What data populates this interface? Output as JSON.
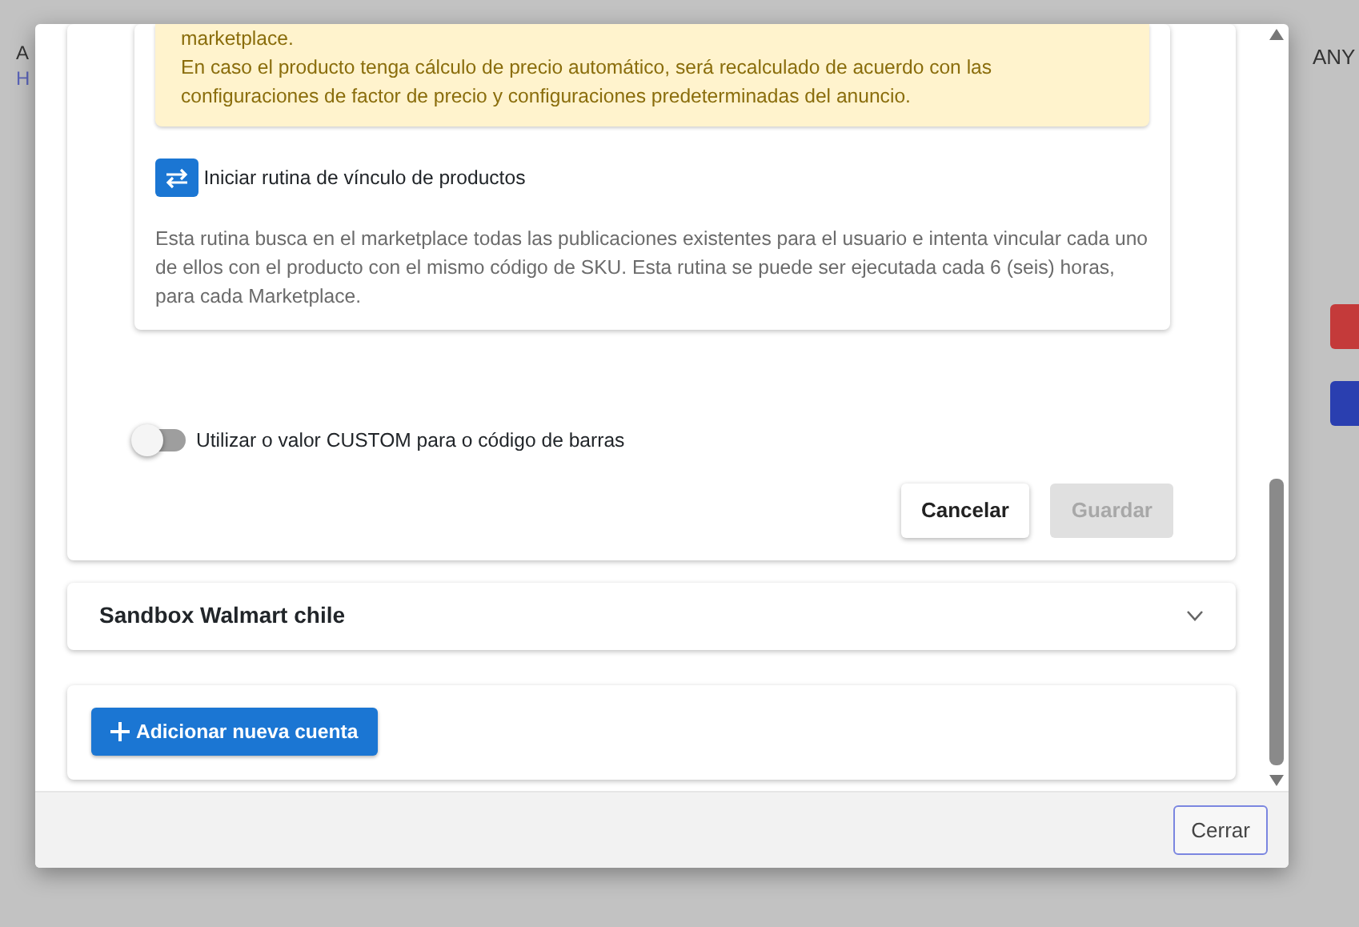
{
  "background_page": {
    "title": "A",
    "link": "H",
    "user": "ANY",
    "buttons": [
      {
        "color": "#c43a3a"
      },
      {
        "color": "#2a3fb0"
      }
    ]
  },
  "modal": {
    "warning": [
      "marketplace.",
      "En caso el producto tenga cálculo de precio automático, será recalculado de acuerdo con las configuraciones de factor de precio y configuraciones predeterminadas del anuncio."
    ],
    "routine": {
      "label": "Iniciar rutina de vínculo de productos",
      "description": "Esta rutina busca en el marketplace todas las publicaciones existentes para el usuario e intenta vincular cada uno de ellos con el producto con el mismo código de SKU. Esta rutina se puede ser ejecutada cada 6 (seis) horas, para cada Marketplace."
    },
    "barcode_toggle": {
      "label": "Utilizar o valor CUSTOM para o código de barras",
      "on": false
    },
    "actions": [
      {
        "label": "Cancelar",
        "disabled": false
      },
      {
        "label": "Guardar",
        "disabled": true
      }
    ],
    "accounts": [
      {
        "name": "Sandbox Walmart chile",
        "expanded": false
      }
    ],
    "add_button": "Adicionar nueva cuenta",
    "close_button": "Cerrar"
  }
}
